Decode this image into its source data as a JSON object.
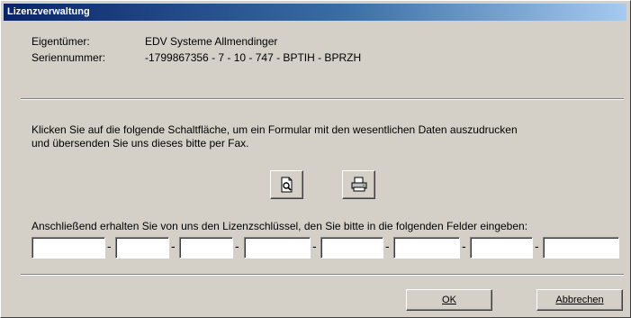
{
  "window": {
    "title": "Lizenzverwaltung"
  },
  "info": {
    "owner_label": "Eigentümer:",
    "owner_value": "EDV Systeme Allmendinger",
    "serial_label": "Seriennummer:",
    "serial_value": "-1799867356 - 7 - 10 - 747 - BPTIH - BPRZH"
  },
  "instructions": {
    "line1": "Klicken Sie auf die folgende Schaltfläche, um ein Formular mit den wesentlichen Daten auszudrucken",
    "line2": "und übersenden Sie uns dieses bitte per Fax.",
    "line3": "Anschließend erhalten Sie von uns den Lizenzschlüssel, den Sie bitte in die folgenden Felder eingeben:"
  },
  "icons": {
    "preview": "print-preview-icon",
    "print": "printer-icon"
  },
  "key_fields": [
    "",
    "",
    "",
    "",
    "",
    "",
    "",
    ""
  ],
  "key_separator": "-",
  "buttons": {
    "ok": "OK",
    "cancel": "Abbrechen"
  }
}
